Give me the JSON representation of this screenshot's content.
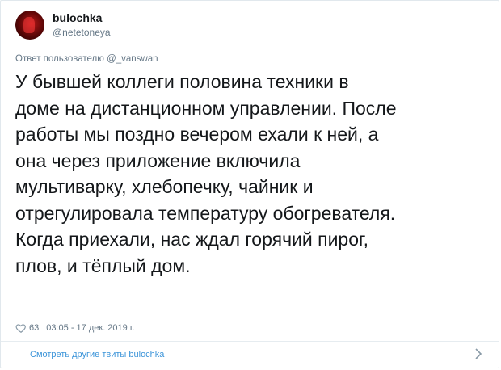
{
  "user": {
    "display_name": "bulochka",
    "handle": "@netetoneya"
  },
  "reply": {
    "text": "Ответ пользователю @_vanswan"
  },
  "tweet": {
    "text": "У бывшей коллеги половина техники в\nдоме на дистанционном управлении. После\nработы мы поздно вечером ехали к ней, а\nона через приложение включила\nмультиварку, хлебопечку, чайник и\nотрегулировала температуру обогревателя.\nКогда приехали, нас ждал горячий пирог,\nплов, и тёплый дом."
  },
  "meta": {
    "likes": "63",
    "timestamp": "03:05 - 17 дек. 2019 г.",
    "heart_icon": "heart-icon"
  },
  "footer": {
    "more_link": "Смотреть другие твиты bulochka",
    "chevron_icon": "chevron-right-icon"
  },
  "colors": {
    "link": "#3b94d9",
    "muted": "#657786",
    "text": "#14171a"
  }
}
